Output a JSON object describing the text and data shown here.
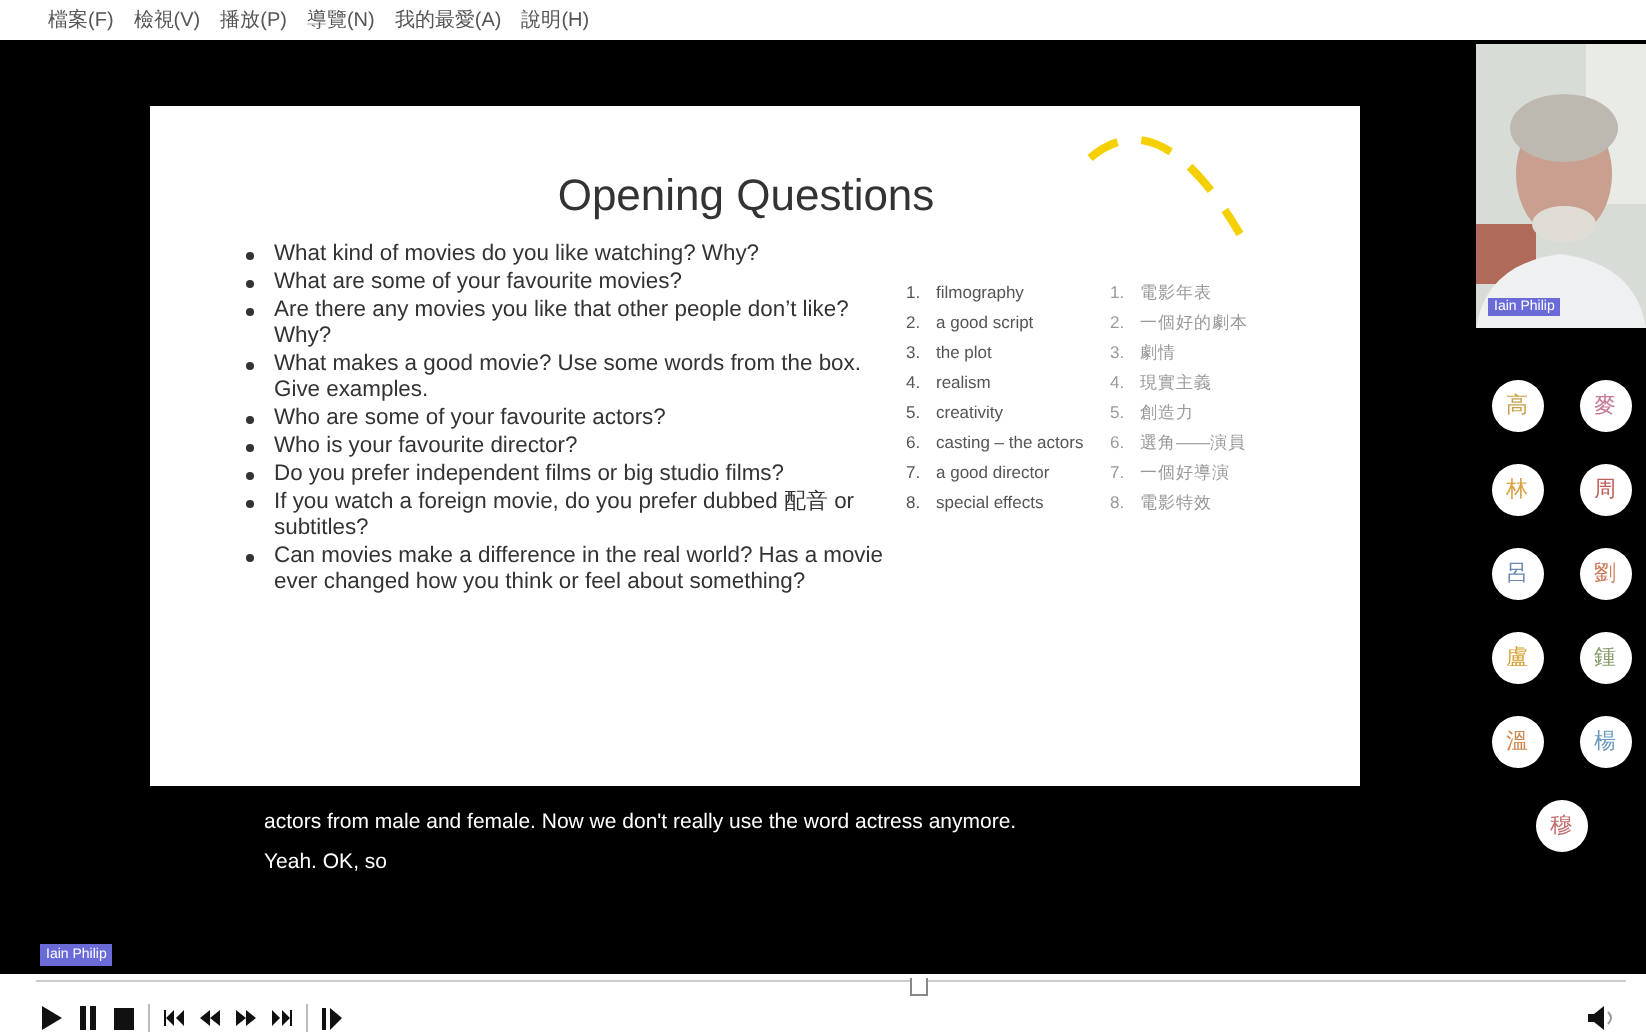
{
  "menu": [
    "檔案(F)",
    "檢視(V)",
    "播放(P)",
    "導覽(N)",
    "我的最愛(A)",
    "說明(H)"
  ],
  "slide": {
    "title": "Opening Questions",
    "questions": [
      "What kind of movies do you like watching? Why?",
      "What are some of your favourite movies?",
      "Are there any movies you like that other people don’t like? Why?",
      "What makes a good movie?  Use some words from the box. Give examples.",
      "Who are some of your favourite actors?",
      "Who is your favourite director?",
      "Do you prefer independent films or big studio films?",
      "If you watch a foreign movie, do you prefer dubbed 配音 or subtitles?",
      "Can movies make a difference in the real world? Has a movie ever changed how you think or feel about something?"
    ],
    "words_en": [
      {
        "num": "1.",
        "text": "filmography"
      },
      {
        "num": "2.",
        "text": "a good script"
      },
      {
        "num": "3.",
        "text": "the plot"
      },
      {
        "num": "4.",
        "text": "realism"
      },
      {
        "num": "5.",
        "text": "creativity"
      },
      {
        "num": "6.",
        "text": "casting – the actors"
      },
      {
        "num": "7.",
        "text": "a good director"
      },
      {
        "num": "8.",
        "text": "special effects"
      }
    ],
    "words_zh": [
      {
        "num": "1.",
        "text": "電影年表"
      },
      {
        "num": "2.",
        "text": "一個好的劇本"
      },
      {
        "num": "3.",
        "text": "劇情"
      },
      {
        "num": "4.",
        "text": "現實主義"
      },
      {
        "num": "5.",
        "text": "創造力"
      },
      {
        "num": "6.",
        "text": "選角——演員"
      },
      {
        "num": "7.",
        "text": "一個好導演"
      },
      {
        "num": "8.",
        "text": "電影特效"
      }
    ]
  },
  "captions": [
    "actors from male and female. Now we don't really use the word actress anymore.",
    "Yeah. OK, so"
  ],
  "speaker": {
    "name": "Iain Philip"
  },
  "participants": [
    {
      "initial": "高",
      "color": "#c9a04a"
    },
    {
      "initial": "麥",
      "color": "#c77a9a"
    },
    {
      "initial": "林",
      "color": "#d9a040"
    },
    {
      "initial": "周",
      "color": "#c0605a"
    },
    {
      "initial": "呂",
      "color": "#6a8ab0"
    },
    {
      "initial": "劉",
      "color": "#d07a5a"
    },
    {
      "initial": "盧",
      "color": "#d4a030"
    },
    {
      "initial": "鍾",
      "color": "#8aa070"
    },
    {
      "initial": "溫",
      "color": "#d08a50"
    },
    {
      "initial": "楊",
      "color": "#6a9ac0"
    },
    {
      "initial": "穆",
      "color": "#c06a6a"
    }
  ],
  "presenter_label": "Iain Philip",
  "playback": {
    "level": 0.55
  }
}
